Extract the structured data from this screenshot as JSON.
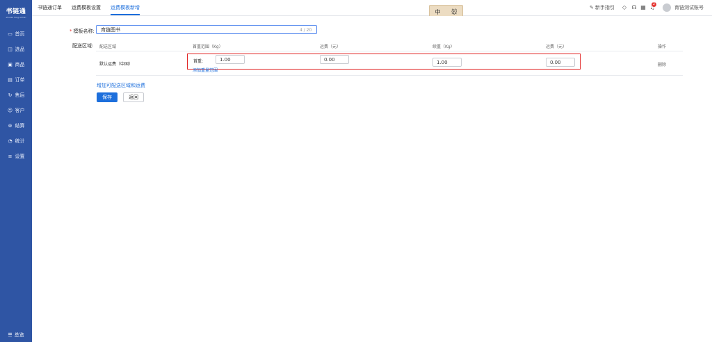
{
  "app": {
    "logo": "书链通",
    "logo_sub": "shulian tong admin"
  },
  "sidebar": {
    "items": [
      {
        "label": "首页",
        "icon": "monitor-icon"
      },
      {
        "label": "选品",
        "icon": "select-icon"
      },
      {
        "label": "商品",
        "icon": "goods-icon"
      },
      {
        "label": "订单",
        "icon": "order-icon"
      },
      {
        "label": "售后",
        "icon": "aftersale-icon"
      },
      {
        "label": "客户",
        "icon": "customer-icon"
      },
      {
        "label": "结算",
        "icon": "settle-icon"
      },
      {
        "label": "统计",
        "icon": "stats-icon"
      },
      {
        "label": "设置",
        "icon": "settings-icon"
      }
    ],
    "bottom": "总览"
  },
  "tabs": [
    {
      "label": "书链通订单"
    },
    {
      "label": "运费模板设置"
    },
    {
      "label": "运费模板新增"
    }
  ],
  "ime": {
    "lang": "中",
    "icon": "mouse-icon"
  },
  "topbar": {
    "guide": "新手指引",
    "badge": "2",
    "account": "育链测试账号"
  },
  "form": {
    "name_label": "模板名称:",
    "name_value": "育链图书",
    "counter": "4 / 20",
    "region_label": "配送区域:"
  },
  "table": {
    "headers": [
      "配送区域",
      "首重范围（Kg）",
      "运费（元）",
      "续重（Kg）",
      "运费（元）",
      "操作"
    ],
    "row": {
      "region": "默认运费（中国）",
      "first_weight_label": "首重:",
      "first_weight": "1.00",
      "first_fee": "0.00",
      "extra_weight": "1.00",
      "extra_fee": "0.00",
      "add_range": "添加重量范围",
      "delete": "删除"
    }
  },
  "actions": {
    "add_region": "增加可配送区域和运费",
    "save": "保存",
    "back": "返回"
  },
  "colors": {
    "sidebar": "#2f55a4",
    "accent": "#1d6fdc",
    "highlight": "#e02020"
  }
}
